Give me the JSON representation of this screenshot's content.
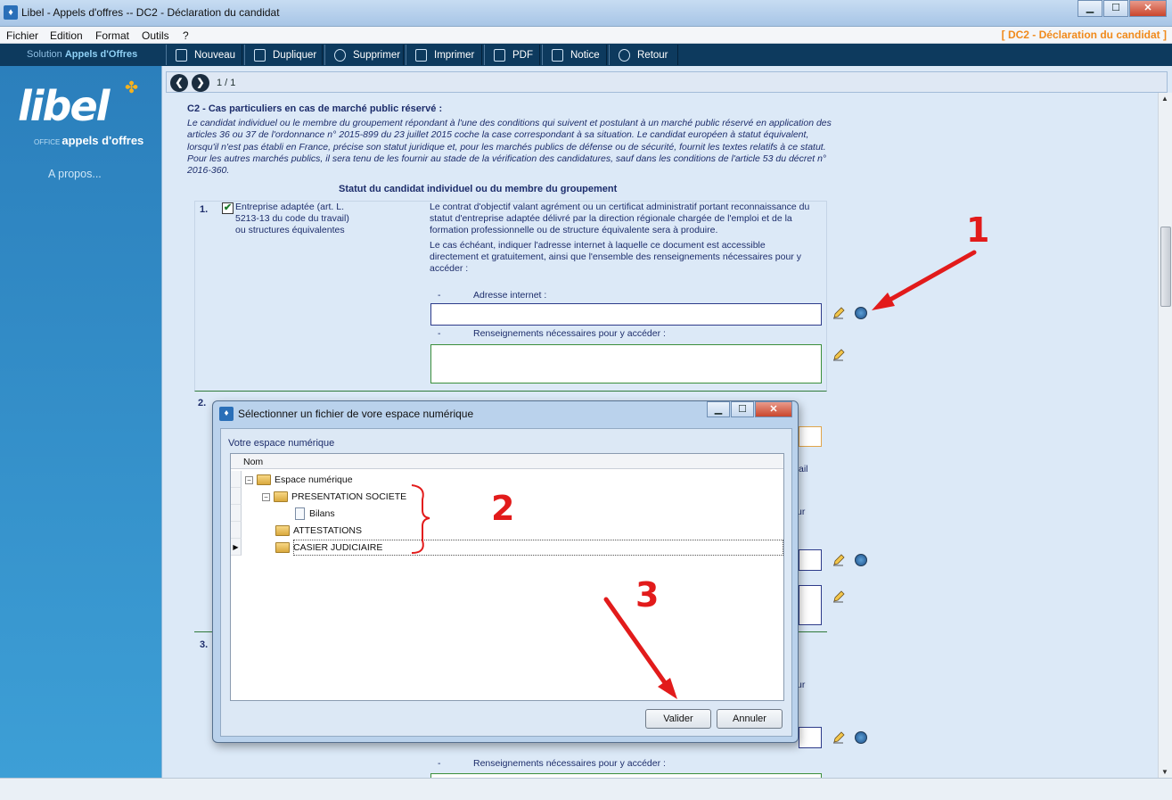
{
  "window": {
    "title": "Libel - Appels d'offres -- DC2 - Déclaration du candidat",
    "min": "▁",
    "max": "☐",
    "close": "✕"
  },
  "menu": {
    "items": [
      "Fichier",
      "Edition",
      "Format",
      "Outils",
      "?"
    ],
    "doc_title": "[ DC2 - Déclaration du candidat ]"
  },
  "toolbar": {
    "solution_prefix": "Solution",
    "solution_name": "Appels d'Offres",
    "buttons": [
      "Nouveau",
      "Dupliquer",
      "Supprimer",
      "Imprimer",
      "PDF",
      "Notice",
      "Retour"
    ]
  },
  "sidebar": {
    "logo": "libel",
    "logo_small": "OFFICE",
    "logo_sub": "appels d'offres",
    "about": "A propos..."
  },
  "nav": {
    "prev": "❮",
    "next": "❯",
    "page": "1 / 1"
  },
  "section": {
    "title": "C2 - Cas particuliers en cas de marché public réservé :",
    "description": "Le candidat individuel ou le membre du groupement répondant à l'une des conditions qui suivent et postulant à un marché public réservé en application des articles 36 ou 37 de l'ordonnance n° 2015-899 du 23 juillet 2015 coche la case correspondant à sa situation. Le candidat européen à statut équivalent, lorsqu'il n'est pas établi en France, précise son statut juridique et, pour les marchés publics de défense ou de sécurité, fournit les textes relatifs à ce statut. Pour les autres marchés publics, il sera tenu de les fournir au stade de la vérification des candidatures, sauf dans les conditions de l'article 53 du décret n° 2016-360.",
    "statut_title": "Statut du candidat individuel ou du membre du groupement"
  },
  "item1": {
    "num": "1.",
    "checked": "✔",
    "label": "Entreprise adaptée (art. L. 5213-13 du code du travail) ou structures équivalentes",
    "text1": "Le contrat d'objectif valant agrément ou un certificat administratif portant reconnaissance du statut d'entreprise adaptée délivré par la direction régionale chargée de l'emploi et de la formation professionnelle ou de structure équivalente sera à produire.",
    "text2": "Le cas échéant, indiquer l'adresse internet à laquelle ce document est accessible directement et gratuitement, ainsi que l'ensemble des renseignements nécessaires pour y accéder :",
    "addr_label": "Adresse internet :",
    "renseign_label": "Renseignements nécessaires pour y accéder :",
    "dash": "-"
  },
  "item2": {
    "num": "2.",
    "partial_text": "ail",
    "partial_text2": "ur"
  },
  "item3": {
    "num": "3.",
    "partial_text": "ur",
    "renseign_label": "Renseignements nécessaires pour y accéder :",
    "dash": "-"
  },
  "dialog": {
    "title": "Sélectionner un fichier de vore espace numérique",
    "section_label": "Votre espace numérique",
    "column": "Nom",
    "tree": [
      {
        "label": "Espace numérique",
        "type": "folder",
        "expander": "−"
      },
      {
        "label": "PRESENTATION SOCIETE",
        "type": "folder",
        "expander": "−"
      },
      {
        "label": "Bilans",
        "type": "file"
      },
      {
        "label": "ATTESTATIONS",
        "type": "folder"
      },
      {
        "label": "CASIER JUDICIAIRE",
        "type": "folder",
        "selected": true
      }
    ],
    "row_pointer": "▶",
    "ok": "Valider",
    "cancel": "Annuler"
  },
  "annotations": {
    "n1": "1",
    "n2": "2",
    "n3": "3",
    "color": "#e21b1b"
  },
  "colors": {
    "toolbar_bg": "#0d3a5e",
    "sidebar": "#2b7fbc",
    "accent_orange": "#f08a1c",
    "text_navy": "#1d2d6b"
  }
}
